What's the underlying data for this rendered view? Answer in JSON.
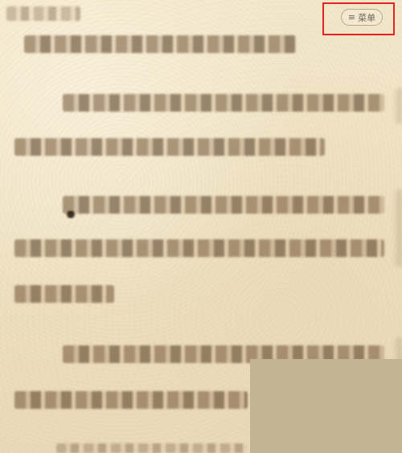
{
  "menu": {
    "icon": "hamburger-icon",
    "icon_glyph": "≡",
    "label": "菜单"
  },
  "colors": {
    "paper": "#f1e4c6",
    "highlight": "#e52222",
    "overlay": "#c2b492",
    "menu_border": "#b9a788",
    "menu_text": "#6e6556"
  }
}
